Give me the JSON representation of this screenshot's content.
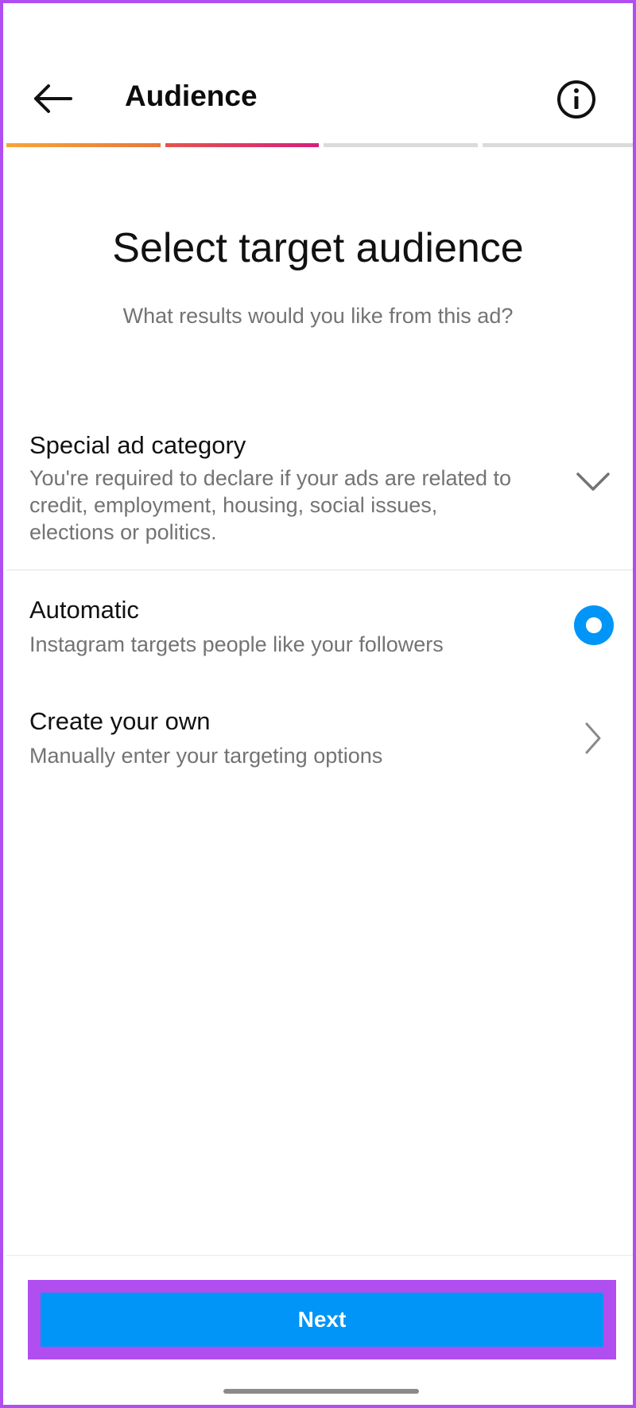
{
  "header": {
    "title": "Audience",
    "back_icon": "arrow-left-icon",
    "info_icon": "info-circle-icon",
    "progress": {
      "steps_total": 4,
      "steps_completed": 2,
      "segment_colors": [
        "#f0973a",
        "#dc2f6f",
        "#dbdbdb",
        "#dbdbdb"
      ]
    }
  },
  "main": {
    "heading": "Select target audience",
    "subheading": "What results would you like from this ad?"
  },
  "options": {
    "special": {
      "label": "Special ad category",
      "description": "You're required to declare if your ads are related to credit, employment, housing, social issues, elections or politics.",
      "icon": "chevron-down-icon"
    },
    "automatic": {
      "label": "Automatic",
      "description": "Instagram targets people like your followers",
      "selected": true
    },
    "create": {
      "label": "Create your own",
      "description": "Manually enter your targeting options",
      "icon": "chevron-right-icon"
    }
  },
  "footer": {
    "next_label": "Next"
  },
  "colors": {
    "accent": "#0095f6",
    "highlight_border": "#b04ef0",
    "secondary_text": "#737373"
  }
}
